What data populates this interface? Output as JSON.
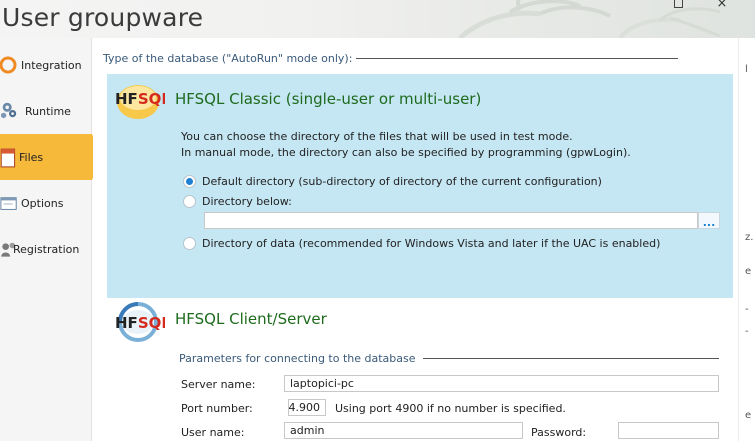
{
  "window": {
    "title": "User groupware",
    "maximize_symbol": "",
    "close_symbol": "×"
  },
  "sidebar": {
    "items": [
      {
        "label": "Integration",
        "icon": "ring-icon"
      },
      {
        "label": "Runtime",
        "icon": "gears-icon"
      },
      {
        "label": "Files",
        "icon": "file-icon",
        "selected": true
      },
      {
        "label": "Options",
        "icon": "window-icon"
      },
      {
        "label": "Registration",
        "icon": "users-icon"
      }
    ]
  },
  "main": {
    "db_type_title": "Type of the database (\"AutoRun\" mode only):",
    "classic": {
      "logo": "HFSQL",
      "heading": "HFSQL Classic (single-user or multi-user)",
      "desc_line1": "You can choose the directory of the files that will be used in test mode.",
      "desc_line2": "In manual mode, the directory can also be specified by programming (gpwLogin).",
      "options": [
        {
          "label": "Default directory (sub-directory of directory of the current configuration)",
          "checked": true
        },
        {
          "label": "Directory below:",
          "checked": false
        },
        {
          "label": "Directory of data (recommended for Windows Vista and later if the UAC is enabled)",
          "checked": false
        }
      ],
      "directory_value": "",
      "browse_label": "..."
    },
    "client_server": {
      "logo": "HFSQL",
      "heading": "HFSQL Client/Server",
      "params_title": "Parameters for connecting to the database",
      "server_label": "Server name:",
      "server_value": "laptopici-pc",
      "port_label": "Port number:",
      "port_value": "4.900",
      "port_hint": "Using port 4900 if no number is specified.",
      "user_label": "User name:",
      "user_value": "admin",
      "password_label": "Password:",
      "password_value": ""
    }
  },
  "right_edge_chars": [
    "l",
    "z.",
    "e",
    "-",
    "-",
    "e"
  ],
  "colors": {
    "accent_selected": "#f6b93a",
    "panel_blue": "#c5e6f3",
    "heading_green": "#1e6b1e",
    "radio_blue": "#1e7fd4",
    "logo_red": "#d42a1e"
  }
}
